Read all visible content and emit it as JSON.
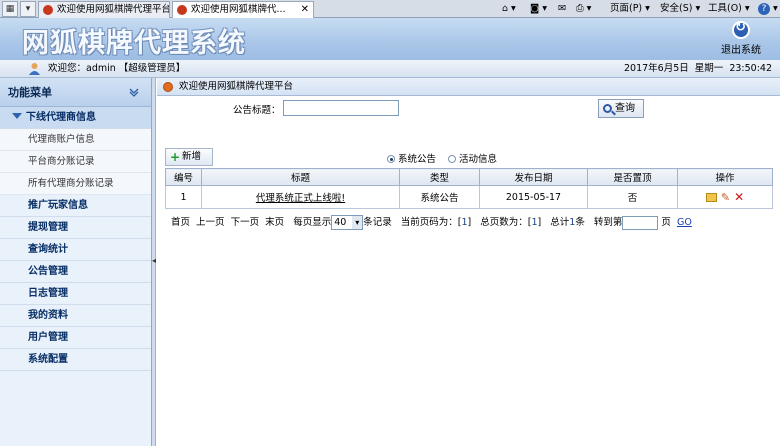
{
  "browser": {
    "tabs": [
      {
        "label": "欢迎使用网狐棋牌代理平台"
      },
      {
        "label": "欢迎使用网狐棋牌代..."
      }
    ],
    "commands": {
      "page": "页面(P)",
      "safety": "安全(S)",
      "tools": "工具(O)"
    }
  },
  "header": {
    "app_title": "网狐棋牌代理系统",
    "logout_label": "退出系统"
  },
  "infobar": {
    "welcome": "欢迎您：admin 【超级管理员】",
    "date": "2017年6月5日",
    "weekday": "星期一",
    "time": "23:50:42"
  },
  "sidebar": {
    "title": "功能菜单",
    "open_group": "下线代理商信息",
    "sub_items": [
      "代理商账户信息",
      "平台商分账记录",
      "所有代理商分账记录"
    ],
    "groups": [
      "推广玩家信息",
      "提现管理",
      "查询统计",
      "公告管理",
      "日志管理",
      "我的资料",
      "用户管理",
      "系统配置"
    ]
  },
  "main": {
    "breadcrumb": "欢迎使用网狐棋牌代理平台",
    "search_label": "公告标题：",
    "search_value": "",
    "search_button": "查询",
    "add_button": "新增",
    "radio_options": [
      {
        "label": "系统公告",
        "checked": true
      },
      {
        "label": "活动信息",
        "checked": false
      }
    ],
    "table": {
      "columns": [
        "编号",
        "标题",
        "类型",
        "发布日期",
        "是否置顶",
        "操作"
      ],
      "rows": [
        {
          "id": "1",
          "title": "代理系统正式上线啦!",
          "type": "系统公告",
          "date": "2015-05-17",
          "pinned": "否"
        }
      ]
    },
    "pager": {
      "first": "首页",
      "prev": "上一页",
      "next": "下一页",
      "last": "末页",
      "per_page_label": "每页显示",
      "per_page_value": "40",
      "records_label": "条记录",
      "current_label": "当前页码为：[",
      "current_value": "1",
      "current_end": "]",
      "total_pages_label": "总页数为：[",
      "total_pages_value": "1",
      "total_pages_end": "]",
      "total_label": "总计",
      "total_value": "1",
      "total_unit": "条",
      "goto_label": "转到第",
      "goto_value": "",
      "page_unit": "页",
      "go": "GO"
    }
  }
}
